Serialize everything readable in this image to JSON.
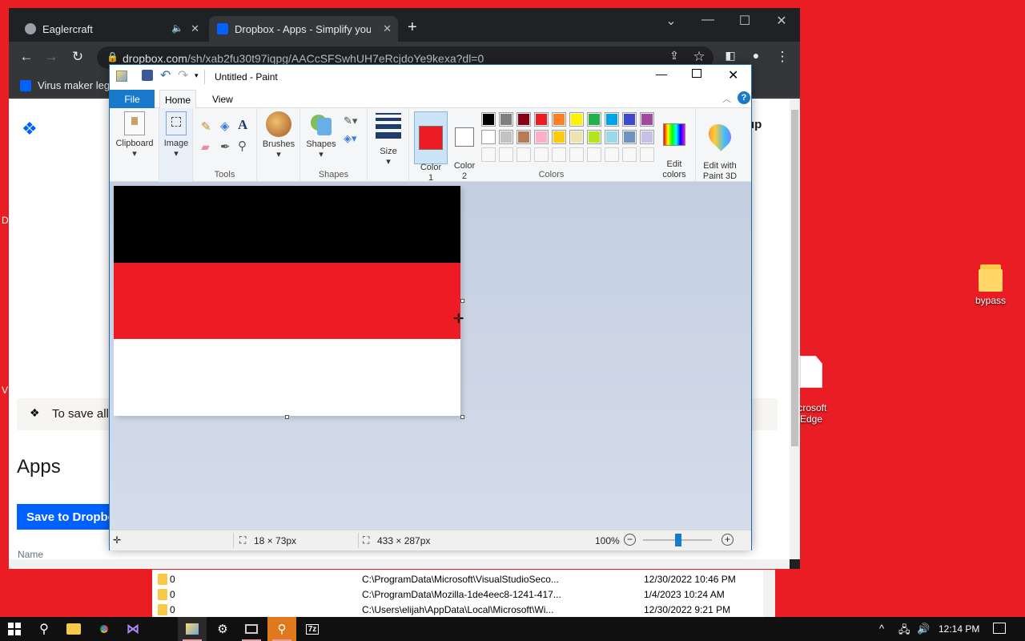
{
  "desktop": {
    "icons": [
      {
        "label": "bypass"
      },
      {
        "label": "icrosoft\nEdge"
      }
    ],
    "left_edge_chars": [
      "D",
      "V"
    ]
  },
  "chrome": {
    "tabs": [
      {
        "title": "Eaglercraft",
        "close": "✕",
        "audio": "🔈"
      },
      {
        "title": "Dropbox - Apps - Simplify your l",
        "close": "✕"
      }
    ],
    "new_tab": "+",
    "url_host": "dropbox.com",
    "url_path": "/sh/xab2fu30t97iqpg/AACcSFSwhUH7eRcjdoYe9kexa?dl=0",
    "bookmark": "Virus maker legi",
    "window_controls": [
      "⌄",
      "—",
      "☐",
      "✕"
    ]
  },
  "dropbox_page": {
    "save_banner": "To save all",
    "heading": "Apps",
    "save_button": "Save to Dropbo",
    "name_col": "Name",
    "signup_partial": "up"
  },
  "paint": {
    "title": "Untitled - Paint",
    "tabs": [
      "File",
      "Home",
      "View"
    ],
    "groups": {
      "clipboard": "Clipboard",
      "image": "Image",
      "tools": "Tools",
      "brushes": "Brushes",
      "shapes_btn": "Shapes",
      "shapes_group": "Shapes",
      "size": "Size",
      "color1": "Color\n1",
      "color2": "Color\n2",
      "colors": "Colors",
      "edit_colors": "Edit\ncolors",
      "paint3d": "Edit with\nPaint 3D"
    },
    "accent": "#1979ca",
    "color1_value": "#ed1c24",
    "color2_value": "#ffffff",
    "palette_row1": [
      "#000000",
      "#7f7f7f",
      "#880015",
      "#ed1c24",
      "#ff7f27",
      "#fff200",
      "#22b14c",
      "#00a2e8",
      "#3f48cc",
      "#a349a4"
    ],
    "palette_row2": [
      "#ffffff",
      "#c3c3c3",
      "#b97a57",
      "#ffaec9",
      "#ffc90e",
      "#efe4b0",
      "#b5e61d",
      "#99d9ea",
      "#7092be",
      "#c8bfe7"
    ],
    "canvas_stripes": [
      "#000000",
      "#ed1c24",
      "#ffffff"
    ],
    "status": {
      "selection": "18 × 73px",
      "size": "433 × 287px",
      "zoom": "100%"
    }
  },
  "file_list": {
    "rows": [
      {
        "count": "0",
        "path": "C:\\ProgramData\\Microsoft\\VisualStudioSeco...",
        "date": "12/30/2022 10:46 PM"
      },
      {
        "count": "0",
        "path": "C:\\ProgramData\\Mozilla-1de4eec8-1241-417...",
        "date": "1/4/2023 10:24 AM"
      },
      {
        "count": "0",
        "path": "C:\\Users\\elijah\\AppData\\Local\\Microsoft\\Wi...",
        "date": "12/30/2022 9:21 PM"
      }
    ]
  },
  "taskbar": {
    "time": "12:14 PM",
    "tray": [
      "^",
      "🖧",
      "🔊"
    ]
  }
}
